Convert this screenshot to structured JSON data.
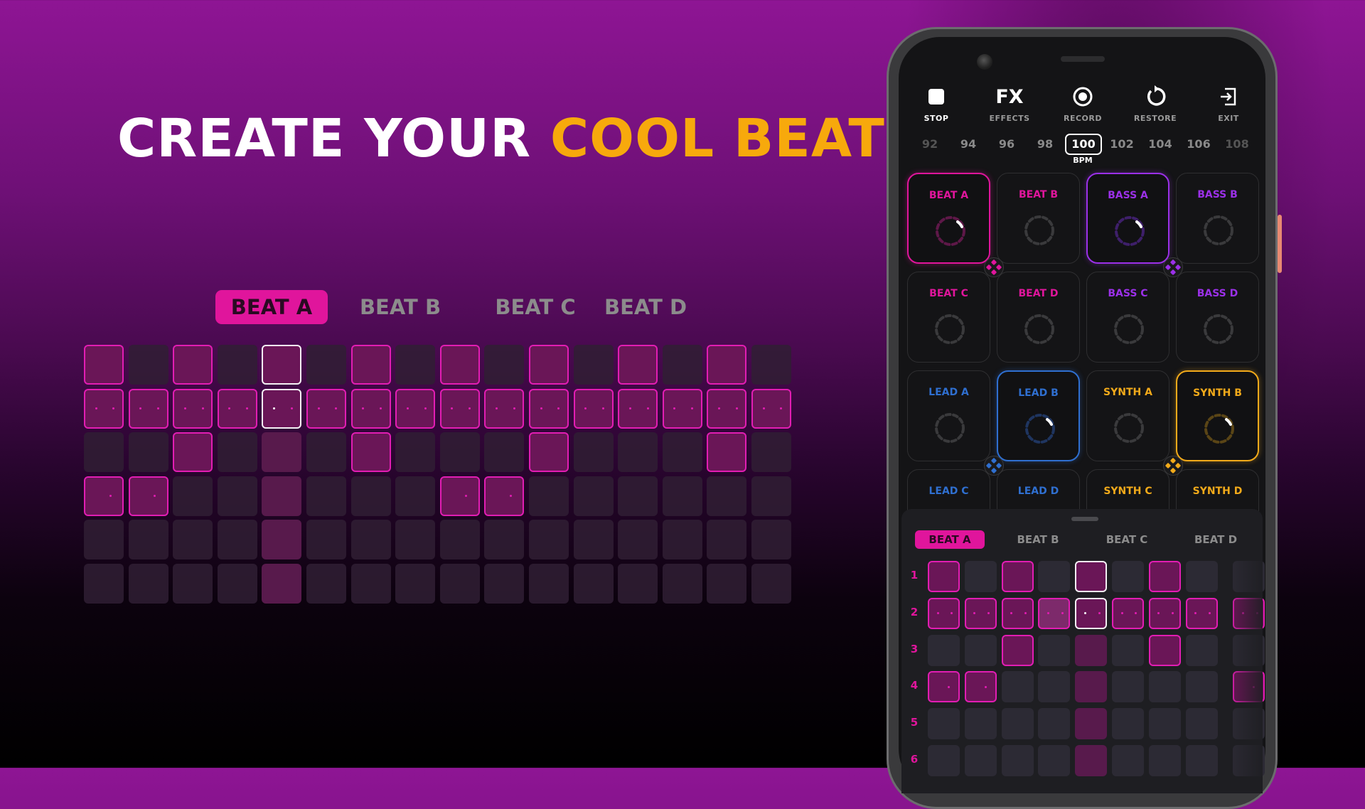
{
  "headline": {
    "part1": "CREATE YOUR",
    "part2": "COOL BEATS"
  },
  "colors": {
    "accent_pink": "#e0159c",
    "accent_purple": "#9b30e8",
    "accent_blue": "#2f6fd0",
    "accent_yellow": "#f2aa1a",
    "headline_yellow": "#f7a90c"
  },
  "showcase": {
    "tabs": [
      {
        "label": "BEAT A",
        "active": true
      },
      {
        "label": "BEAT B",
        "active": false
      },
      {
        "label": "BEAT C",
        "active": false
      },
      {
        "label": "BEAT D",
        "active": false
      }
    ],
    "grid": {
      "rows": 6,
      "cols": 16,
      "current_step": 5,
      "active": [
        [
          1,
          0,
          1,
          0,
          1,
          0,
          1,
          0,
          1,
          0,
          1,
          0,
          1,
          0,
          1,
          0
        ],
        [
          1,
          1,
          1,
          1,
          1,
          1,
          1,
          1,
          1,
          1,
          1,
          1,
          1,
          1,
          1,
          1
        ],
        [
          0,
          0,
          1,
          0,
          0,
          0,
          1,
          0,
          0,
          0,
          1,
          0,
          0,
          0,
          1,
          0
        ],
        [
          1,
          1,
          0,
          0,
          0,
          0,
          0,
          0,
          1,
          1,
          0,
          0,
          0,
          0,
          0,
          0
        ],
        [
          0,
          0,
          0,
          0,
          0,
          0,
          0,
          0,
          0,
          0,
          0,
          0,
          0,
          0,
          0,
          0
        ],
        [
          0,
          0,
          0,
          0,
          0,
          0,
          0,
          0,
          0,
          0,
          0,
          0,
          0,
          0,
          0,
          0
        ]
      ],
      "dots": [
        [
          0,
          0,
          0,
          0,
          0,
          0,
          0,
          0,
          0,
          0,
          0,
          0,
          0,
          0,
          0,
          0
        ],
        [
          2,
          2,
          2,
          2,
          2,
          2,
          2,
          2,
          2,
          2,
          2,
          2,
          2,
          2,
          2,
          2
        ],
        [
          0,
          0,
          0,
          0,
          0,
          0,
          0,
          0,
          0,
          0,
          0,
          0,
          0,
          0,
          0,
          0
        ],
        [
          1,
          1,
          0,
          0,
          0,
          0,
          0,
          0,
          1,
          1,
          0,
          0,
          0,
          0,
          0,
          0
        ],
        [
          0,
          0,
          0,
          0,
          0,
          0,
          0,
          0,
          0,
          0,
          0,
          0,
          0,
          0,
          0,
          0
        ],
        [
          0,
          0,
          0,
          0,
          0,
          0,
          0,
          0,
          0,
          0,
          0,
          0,
          0,
          0,
          0,
          0
        ]
      ]
    }
  },
  "app": {
    "toolbar": [
      {
        "id": "stop",
        "label": "STOP",
        "icon": "stop-icon"
      },
      {
        "id": "effects",
        "label": "EFFECTS",
        "icon_text": "FX",
        "icon": "fx-icon"
      },
      {
        "id": "record",
        "label": "RECORD",
        "icon": "record-icon"
      },
      {
        "id": "restore",
        "label": "RESTORE",
        "icon": "restore-icon"
      },
      {
        "id": "exit",
        "label": "EXIT",
        "icon": "exit-icon"
      }
    ],
    "bpm": {
      "options": [
        "92",
        "94",
        "96",
        "98",
        "100",
        "102",
        "104",
        "106",
        "108"
      ],
      "selected": "100",
      "label": "BPM"
    },
    "pads": [
      {
        "label": "BEAT A",
        "group": "pink",
        "active": true
      },
      {
        "label": "BEAT B",
        "group": "pink",
        "active": false
      },
      {
        "label": "BASS A",
        "group": "purple",
        "active": true
      },
      {
        "label": "BASS B",
        "group": "purple",
        "active": false
      },
      {
        "label": "BEAT C",
        "group": "pink",
        "active": false
      },
      {
        "label": "BEAT D",
        "group": "pink",
        "active": false
      },
      {
        "label": "BASS C",
        "group": "purple",
        "active": false
      },
      {
        "label": "BASS D",
        "group": "purple",
        "active": false
      },
      {
        "label": "LEAD A",
        "group": "blue",
        "active": false
      },
      {
        "label": "LEAD B",
        "group": "blue",
        "active": true
      },
      {
        "label": "SYNTH A",
        "group": "yellow",
        "active": false
      },
      {
        "label": "SYNTH B",
        "group": "yellow",
        "active": true
      },
      {
        "label": "LEAD C",
        "group": "blue",
        "active": false
      },
      {
        "label": "LEAD D",
        "group": "blue",
        "active": false
      },
      {
        "label": "SYNTH C",
        "group": "yellow",
        "active": false
      },
      {
        "label": "SYNTH D",
        "group": "yellow",
        "active": false
      }
    ],
    "sheet": {
      "tabs": [
        {
          "label": "BEAT A",
          "active": true
        },
        {
          "label": "BEAT B",
          "active": false
        },
        {
          "label": "BEAT C",
          "active": false
        },
        {
          "label": "BEAT D",
          "active": false
        }
      ],
      "row_labels": [
        "1",
        "2",
        "3",
        "4",
        "5",
        "6"
      ]
    }
  }
}
